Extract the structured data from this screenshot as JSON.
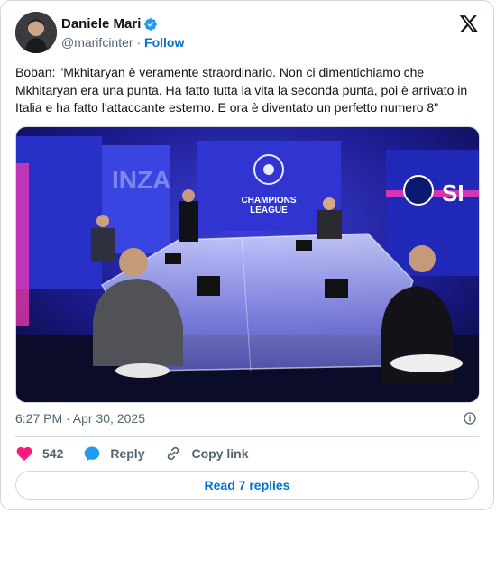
{
  "author": {
    "display_name": "Daniele Mari",
    "handle": "@marifcinter",
    "separator": "·",
    "follow_label": "Follow"
  },
  "tweet": {
    "text": "Boban: \"Mkhitaryan è veramente straordinario. Non ci dimentichiamo che Mkhitaryan era una punta. Ha fatto tutta la vita la seconda punta, poi è arrivato in Italia e ha fatto l'attaccante esterno. E ora è diventato un perfetto numero 8\"",
    "timestamp": "6:27 PM · Apr 30, 2025"
  },
  "media": {
    "backdrop_left": "INZA",
    "backdrop_center_line1": "CHAMPIONS",
    "backdrop_center_line2": "LEAGUE",
    "backdrop_right": "SI"
  },
  "actions": {
    "like_count": "542",
    "reply_label": "Reply",
    "copy_label": "Copy link"
  },
  "read_replies_label": "Read 7 replies",
  "colors": {
    "accent": "#0074d4",
    "like": "#f91880",
    "verified": "#1d9bf0",
    "muted": "#536471",
    "border": "#cfd9de"
  },
  "icons": [
    "verified-badge-icon",
    "x-logo-icon",
    "info-icon",
    "heart-icon",
    "reply-bubble-icon",
    "link-icon"
  ]
}
